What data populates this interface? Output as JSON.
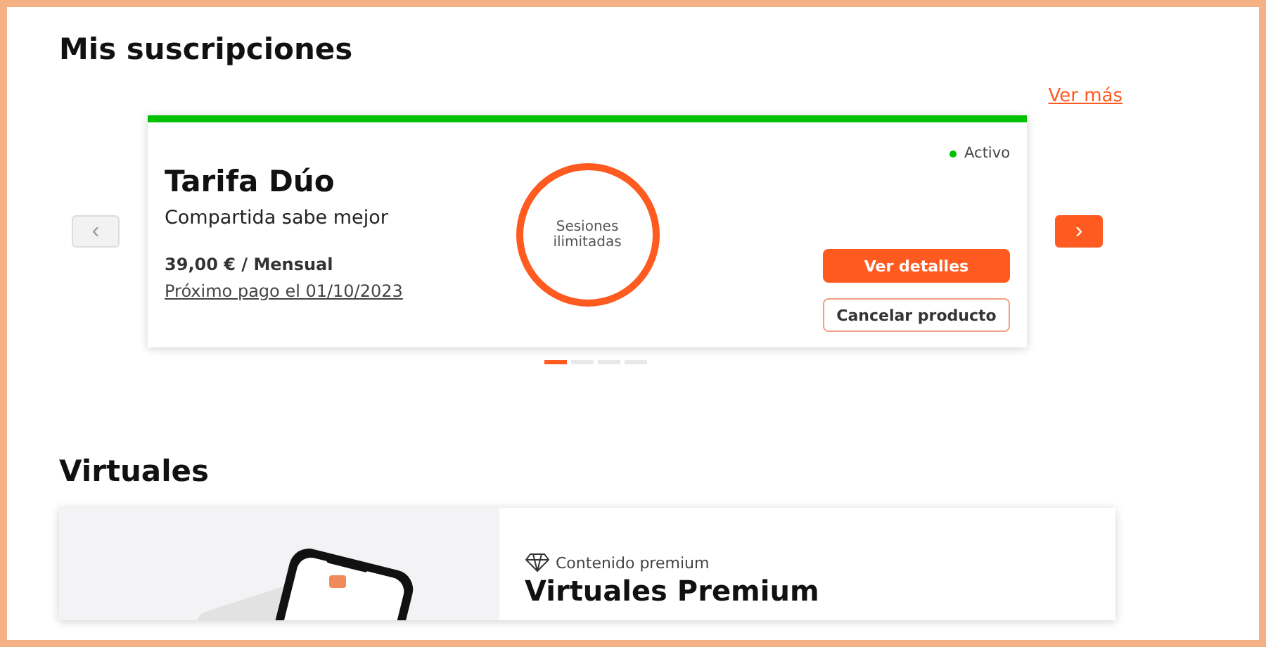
{
  "subscriptions": {
    "title": "Mis suscripciones",
    "see_more": "Ver más",
    "card": {
      "name": "Tarifa Dúo",
      "tagline": "Compartida sabe mejor",
      "price": "39,00 € / Mensual",
      "next_payment": "Próximo pago el 01/10/2023",
      "status": {
        "label": "Activo",
        "color": "#00c000"
      },
      "circle_text": "Sesiones ilimitadas",
      "buttons": [
        {
          "label": "Ver detalles",
          "kind": "primary"
        },
        {
          "label": "Cancelar producto",
          "kind": "outline"
        }
      ]
    },
    "carousel_prev": {
      "label": "‹",
      "disabled": true
    },
    "carousel_next": {
      "label": "›",
      "disabled": false
    },
    "dots": [
      {
        "selected": true
      },
      {
        "selected": false
      },
      {
        "selected": false
      },
      {
        "selected": false
      }
    ]
  },
  "virtuales": {
    "title": "Virtuales",
    "card": {
      "badge": "Contenido premium",
      "name": "Virtuales Premium",
      "kind": "picture"
    }
  }
}
